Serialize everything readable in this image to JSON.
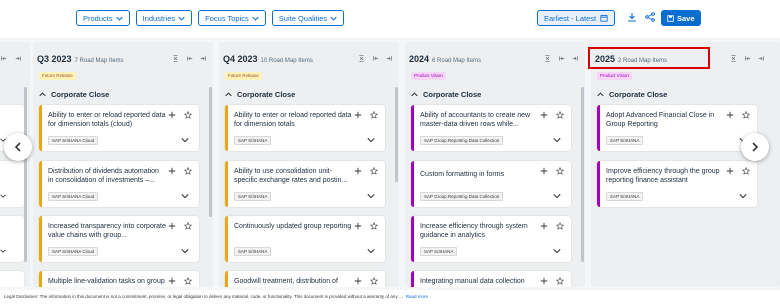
{
  "toolbar": {
    "filters": [
      "Products",
      "Industries",
      "Focus Topics",
      "Suite Qualities"
    ],
    "sort_label": "Earliest - Latest",
    "save_label": "Save",
    "accent_color": "#0a6ed1"
  },
  "columns": [
    {
      "title": "Q3 2023",
      "count": "7 Road Map Items",
      "tag": "Future Release",
      "section": "Corporate Close",
      "cards": [
        {
          "title": "Ability to enter or reload reported data for dimension totals (cloud)",
          "chip": "SAP S/4HANA Cloud"
        },
        {
          "title": "Distribution of dividends automation in consolidation of investments –...",
          "chip": "SAP S/4HANA Cloud"
        },
        {
          "title": "Increased transparency into corporate value chains with group...",
          "chip": "SAP S/4HANA Cloud"
        },
        {
          "title": "Multiple line-validation tasks on group reporting and unreleased...",
          "chip": ""
        }
      ]
    },
    {
      "title": "Q4 2023",
      "count": "10 Road Map Items",
      "tag": "Future Release",
      "section": "Corporate Close",
      "cards": [
        {
          "title": "Ability to enter or reload reported data for dimension totals",
          "chip": "SAP S/4HANA"
        },
        {
          "title": "Ability to use consolidation unit-specific exchange rates and postin...",
          "chip": "SAP S/4HANA"
        },
        {
          "title": "Continuously updated group reporting",
          "chip": "SAP S/4HANA"
        },
        {
          "title": "Goodwill treatment, distribution of dividends, and method change...",
          "chip": ""
        }
      ]
    },
    {
      "title": "2024",
      "count": "6 Road Map Items",
      "tag": "Product Vision",
      "section": "Corporate Close",
      "cards": [
        {
          "title": "Ability of accountants to create new master-data driven rows while...",
          "chip": "SAP Group Reporting Data Collection"
        },
        {
          "title": "Custom formatting in forms",
          "chip": "SAP Group Reporting Data Collection"
        },
        {
          "title": "Increase efficiency through system guidance in analytics",
          "chip": "SAP S/4HANA"
        },
        {
          "title": "Integrating manual data collection with totals validation task results",
          "chip": ""
        }
      ]
    },
    {
      "title": "2025",
      "count": "2 Road Map Items",
      "tag": "Product Vision",
      "section": "Corporate Close",
      "cards": [
        {
          "title": "Adopt Advanced Financial Close in Group Reporting",
          "chip": "SAP S/4HANA"
        },
        {
          "title": "Improve efficiency through the group reporting finance assistant",
          "chip": "SAP S/4HANA"
        }
      ]
    }
  ],
  "footer": {
    "disclaimer": "Legal Disclaimer: The information in this document is not a commitment, promise, or legal obligation to deliver any material, code, or functionality. This document is provided without a warranty of any ...",
    "more_label": "Read more"
  }
}
